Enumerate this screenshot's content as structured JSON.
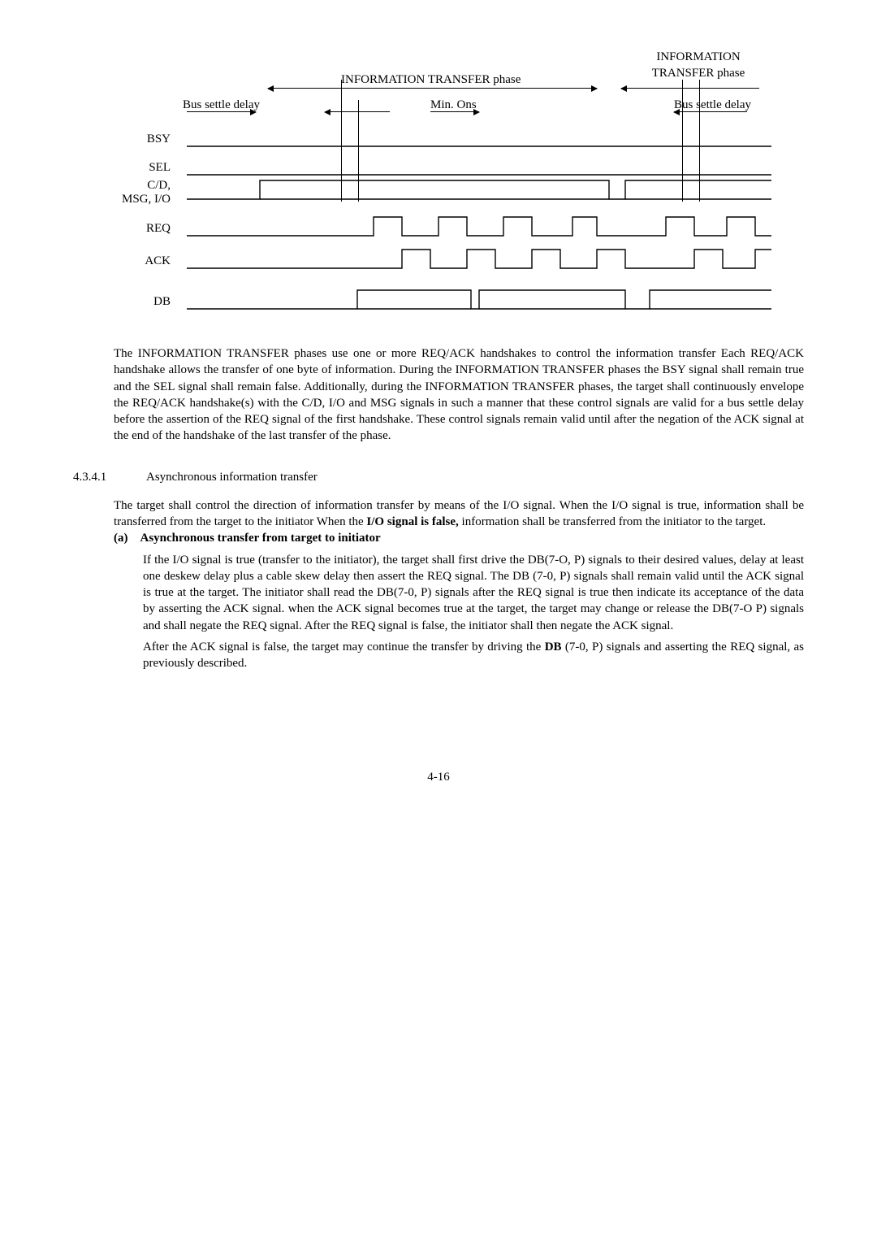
{
  "chart_data": {
    "type": "timing-diagram",
    "phase_main": "INFORMATION TRANSFER phase",
    "phase_right_top": "INFORMATION",
    "phase_right_bot": "TRANSFER phase",
    "annotations": {
      "bus_settle_left": "Bus settle delay",
      "min_ons": "Min. Ons",
      "bus_settle_right": "Bus settle delay"
    },
    "signals": [
      "BSY",
      "SEL",
      "C/D,\nMSG, I/O",
      "REQ",
      "ACK",
      "DB"
    ]
  },
  "paragraph1": "The INFORMATION TRANSFER phases use one or more REQ/ACK handshakes to control the information transfer Each REQ/ACK handshake allows the transfer of one byte of information. During the INFORMATION TRANSFER phases the BSY signal shall remain true and the SEL signal shall remain false. Additionally, during the INFORMATION TRANSFER phases, the target shall continuously envelope the REQ/ACK handshake(s) with the C/D, I/O and MSG signals in such a manner that these control signals are valid for a bus settle delay before the assertion of the REQ signal of the first handshake. These control signals remain valid until after the negation of the ACK signal at the end of the handshake of the last transfer of the phase.",
  "section": {
    "num": "4.3.4.1",
    "title": "Asynchronous information transfer"
  },
  "paragraph2_a": "The target shall control the direction of information transfer by means of the I/O signal. When the I/O signal is true, information shall be transferred from the target to the initiator When the ",
  "paragraph2_bold": "I/O signal is false,",
  "paragraph2_b": " information shall be transferred from the initiator to the target.",
  "item_a": {
    "marker": "(a)",
    "title": "Asynchronous transfer from target to initiator",
    "body1": "If the I/O signal is true (transfer to the initiator), the target shall first drive the DB(7-O, P) signals to their desired values, delay at least one deskew delay plus a cable skew delay then assert the REQ signal. The DB (7-0, P) signals shall remain valid until the ACK signal is true at the target. The initiator shall read the DB(7-0, P) signals after the REQ signal is true then indicate its acceptance of the data by asserting the ACK signal. when the ACK signal becomes true at the target, the target may change or release the DB(7-O P) signals and shall negate the REQ signal. After the REQ signal is false, the initiator shall then negate the ACK signal.",
    "body2a": "After the ACK signal is false, the target may continue the transfer by driving the ",
    "body2bold": "DB",
    "body2b": " (7-0, P) signals and asserting the REQ signal, as previously described."
  },
  "page_number": "4-16"
}
